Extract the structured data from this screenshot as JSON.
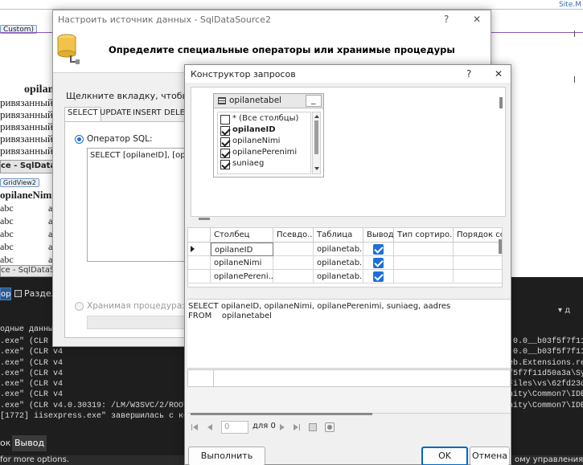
{
  "background": {
    "site_label": "Site.M",
    "custom_tag": "Custom)",
    "col_header_1": "opilane",
    "bound_rows": [
      "ривязанный",
      "ривязанный",
      "ривязанный",
      "ривязанный",
      "ривязанный"
    ],
    "datasource_1": "ce - SqlDataSour",
    "gridview_tab": "GridView2",
    "grid_col_1": "opilaneNimi",
    "grid_rows": [
      {
        "a": "abc",
        "b": "a"
      },
      {
        "a": "abc",
        "b": "a"
      },
      {
        "a": "abc",
        "b": "a"
      },
      {
        "a": "abc",
        "b": "a"
      },
      {
        "a": "abc",
        "b": "a"
      }
    ],
    "datasource_2": "ce - SqlDataSour",
    "toolbar_left": "ор",
    "toolbar_sep": "Раздели",
    "output_header": "одные данные",
    "output_lines_left": [
      ".exe\" (CLR v4",
      ".exe\" (CLR v4",
      ".exe\" (CLR v4",
      ".exe\" (CLR v4",
      ".exe\" (CLR v4",
      ".exe\" (CLR v4",
      ".exe\" (CLR v4.0.30319: /LM/W3SVC/2/ROOT-1-133",
      "[1772] iisexpress.exe\" завершилась с кодом 42"
    ],
    "output_lines_right": [
      ".0.0__b03f5f7f11d",
      ".0.0__b03f5f7f11d",
      "eb.Extensions.res",
      "f5f7f11d50a3a\\Sys",
      " Files\\vs\\62fd23d",
      "nity\\Common7\\IDE\\",
      "nity\\Common7\\IDE\\"
    ],
    "bottom_tab_1": "ок",
    "bottom_tab_2": "Вывод",
    "status_left": "for more options.",
    "status_right": "ому управления вер",
    "right_arrow": "▾ д"
  },
  "wizard": {
    "title": "Настроить источник данных - SqlDataSource2",
    "help": "?",
    "close": "✕",
    "heading": "Определите специальные операторы или хранимые процедуры",
    "instruction": "Щелкните вкладку, чтобы создать",
    "tabs": [
      "SELECT",
      "UPDATE",
      "INSERT",
      "DELETE"
    ],
    "radio_sql_label": "Оператор SQL:",
    "sql_text": "SELECT [opilaneID], [opilan",
    "radio_proc_label": "Хранимая процедура:"
  },
  "query_builder": {
    "title": "Конструктор запросов",
    "help": "?",
    "close": "✕",
    "table_widget": {
      "name": "opilanetabel",
      "minimize": "_",
      "columns": [
        {
          "label": "* (Все столбцы)",
          "checked": false,
          "bold": false
        },
        {
          "label": "opilaneID",
          "checked": true,
          "bold": true
        },
        {
          "label": "opilaneNimi",
          "checked": true,
          "bold": false
        },
        {
          "label": "opilanePerenimi",
          "checked": true,
          "bold": false
        },
        {
          "label": "suniaeg",
          "checked": true,
          "bold": false
        }
      ]
    },
    "grid_headers": [
      "Столбец",
      "Псевдо...",
      "Таблица",
      "Вывод",
      "Тип сортиро...",
      "Порядок сор"
    ],
    "grid_rows": [
      {
        "column": "opilaneID",
        "alias": "",
        "table": "opilanetab...",
        "output": true
      },
      {
        "column": "opilaneNimi",
        "alias": "",
        "table": "opilanetab...",
        "output": true
      },
      {
        "column": "opilanePereni...",
        "alias": "",
        "table": "opilanetab...",
        "output": true
      }
    ],
    "sql_line_1": "SELECT opilaneID, opilaneNimi, opilanePerenimi, suniaeg, aadres",
    "sql_line_2": "FROM    opilanetabel",
    "nav": {
      "page_value": "0",
      "of_label": "для 0"
    },
    "execute_button": "Выполнить запрос",
    "ok_button": "OK",
    "cancel_button": "Отмена"
  },
  "colors": {
    "dark_panel": "#1e1e1e",
    "bluechk": "#1e6fd9",
    "wizard_bg": "#f0f0f0"
  }
}
